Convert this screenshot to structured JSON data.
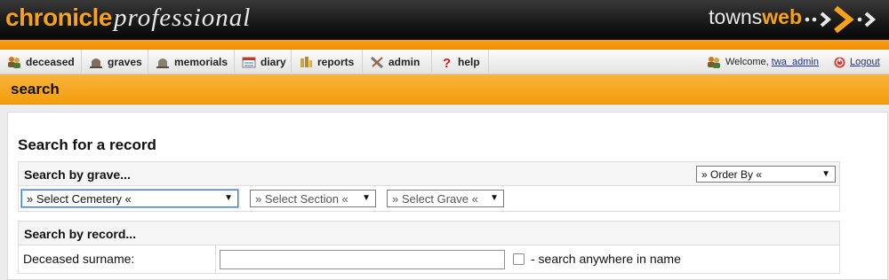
{
  "brand": {
    "left_part1": "chronicle",
    "left_part2": "professional",
    "right_part1": "towns",
    "right_part2": "web",
    "accent_color": "#f7a21b"
  },
  "nav": {
    "items": [
      {
        "label": "deceased",
        "icon": "people-icon"
      },
      {
        "label": "graves",
        "icon": "grave-icon"
      },
      {
        "label": "memorials",
        "icon": "memorial-icon"
      },
      {
        "label": "diary",
        "icon": "calendar-icon"
      },
      {
        "label": "reports",
        "icon": "reports-icon"
      },
      {
        "label": "admin",
        "icon": "tools-icon"
      },
      {
        "label": "help",
        "icon": "help-icon"
      }
    ],
    "welcome_text": "Welcome,",
    "username": "twa_admin",
    "logout_label": "Logout"
  },
  "page": {
    "section_title": "search",
    "heading": "Search for a record"
  },
  "search_by_grave": {
    "label": "Search by grave...",
    "order_by": "» Order By «",
    "cemetery": "» Select Cemetery «",
    "section": "» Select Section «",
    "grave": "» Select Grave «"
  },
  "search_by_record": {
    "label": "Search by record...",
    "surname_label": "Deceased surname:",
    "surname_value": "",
    "anywhere_label": "- search anywhere in name",
    "anywhere_checked": false
  }
}
